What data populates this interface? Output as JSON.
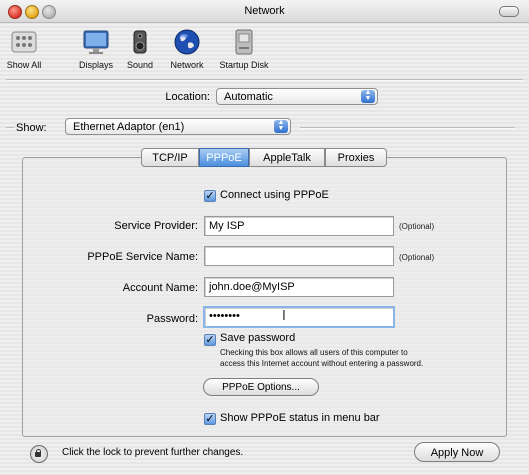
{
  "window": {
    "title": "Network"
  },
  "toolbar": {
    "items": [
      {
        "label": "Show All",
        "icon": "show-all-icon"
      },
      {
        "label": "Displays",
        "icon": "displays-icon"
      },
      {
        "label": "Sound",
        "icon": "sound-icon"
      },
      {
        "label": "Network",
        "icon": "network-globe-icon"
      },
      {
        "label": "Startup Disk",
        "icon": "startup-disk-icon"
      }
    ]
  },
  "location": {
    "label": "Location:",
    "value": "Automatic"
  },
  "show": {
    "label": "Show:",
    "value": "Ethernet Adaptor (en1)"
  },
  "tabs": [
    {
      "label": "TCP/IP",
      "selected": false
    },
    {
      "label": "PPPoE",
      "selected": true
    },
    {
      "label": "AppleTalk",
      "selected": false
    },
    {
      "label": "Proxies",
      "selected": false
    }
  ],
  "pppoe": {
    "connect": {
      "label": "Connect using PPPoE",
      "checked": true
    },
    "service_provider": {
      "label": "Service Provider:",
      "value": "My ISP",
      "note": "(Optional)"
    },
    "service_name": {
      "label": "PPPoE Service Name:",
      "value": "",
      "note": "(Optional)"
    },
    "account_name": {
      "label": "Account Name:",
      "value": "john.doe@MyISP"
    },
    "password": {
      "label": "Password:",
      "value": "••••••••"
    },
    "save_password": {
      "label": "Save password",
      "checked": true,
      "help_line1": "Checking this box allows all users of this computer to",
      "help_line2": "access this Internet account without entering a password."
    },
    "options_button": "PPPoE Options...",
    "show_status": {
      "label": "Show PPPoE status in menu bar",
      "checked": true
    }
  },
  "footer": {
    "lock_text": "Click the lock to prevent further changes.",
    "apply_button": "Apply Now"
  },
  "colors": {
    "accent": "#4c8fde",
    "focus_ring": "#8bb4e8"
  }
}
